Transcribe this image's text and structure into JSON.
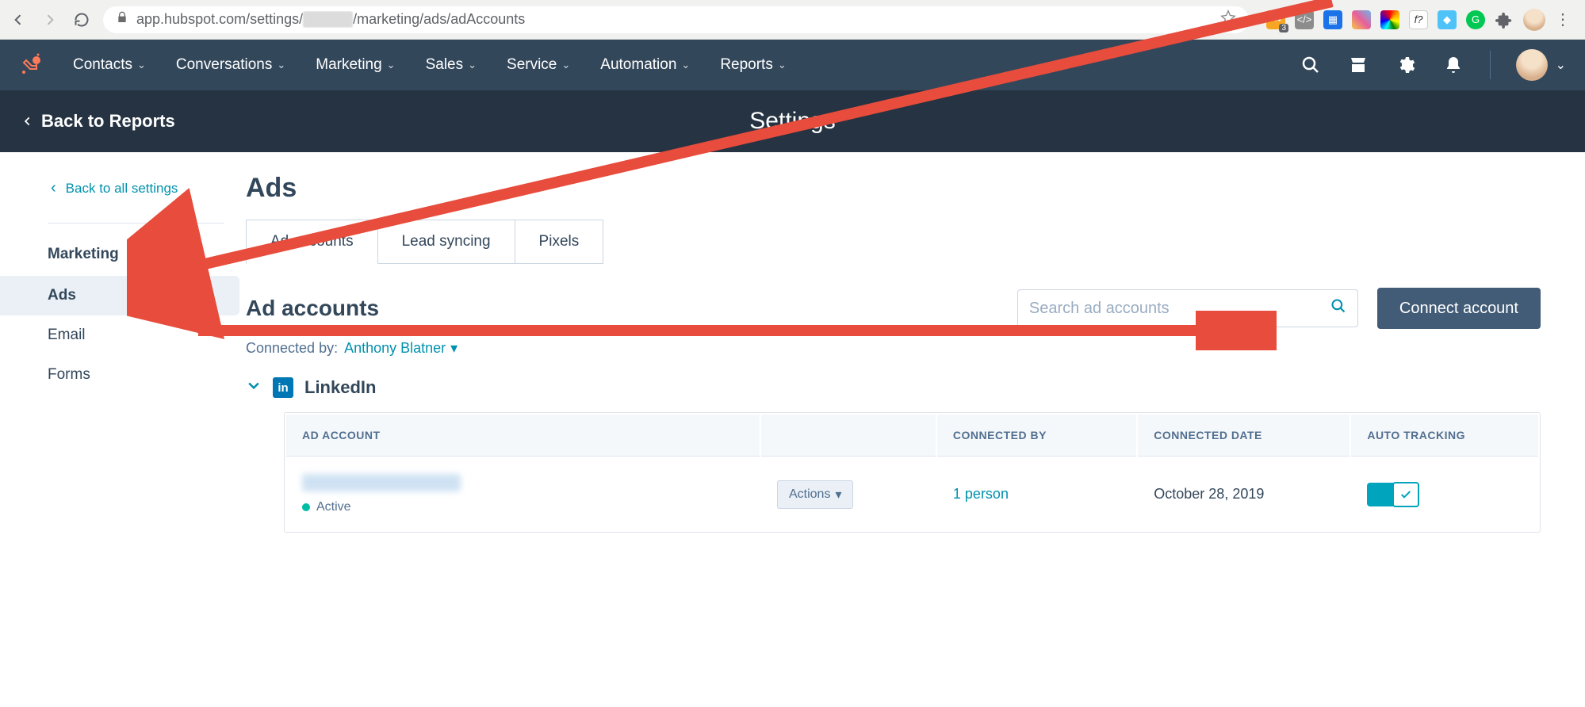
{
  "browser": {
    "url_prefix": "app.hubspot.com/settings/",
    "url_blur": "xxxxxxx",
    "url_suffix": "/marketing/ads/adAccounts",
    "ext_badge_count": "3"
  },
  "nav": {
    "items": [
      "Contacts",
      "Conversations",
      "Marketing",
      "Sales",
      "Service",
      "Automation",
      "Reports"
    ]
  },
  "subheader": {
    "back": "Back to Reports",
    "title": "Settings"
  },
  "sidebar": {
    "back_all": "Back to all settings",
    "section": "Marketing",
    "items": [
      "Ads",
      "Email",
      "Forms"
    ],
    "active": 0
  },
  "page": {
    "title": "Ads",
    "tabs": [
      "Ad accounts",
      "Lead syncing",
      "Pixels"
    ],
    "active_tab": 0,
    "section_heading": "Ad accounts",
    "search_placeholder": "Search ad accounts",
    "connect_button": "Connect account",
    "connected_by_label": "Connected by:",
    "connected_by_name": "Anthony Blatner",
    "group_name": "LinkedIn",
    "table": {
      "headers": [
        "AD ACCOUNT",
        "",
        "CONNECTED BY",
        "CONNECTED DATE",
        "AUTO TRACKING"
      ],
      "row": {
        "status": "Active",
        "actions": "Actions",
        "connected_by": "1 person",
        "connected_date": "October 28, 2019",
        "auto_tracking": true
      }
    }
  }
}
